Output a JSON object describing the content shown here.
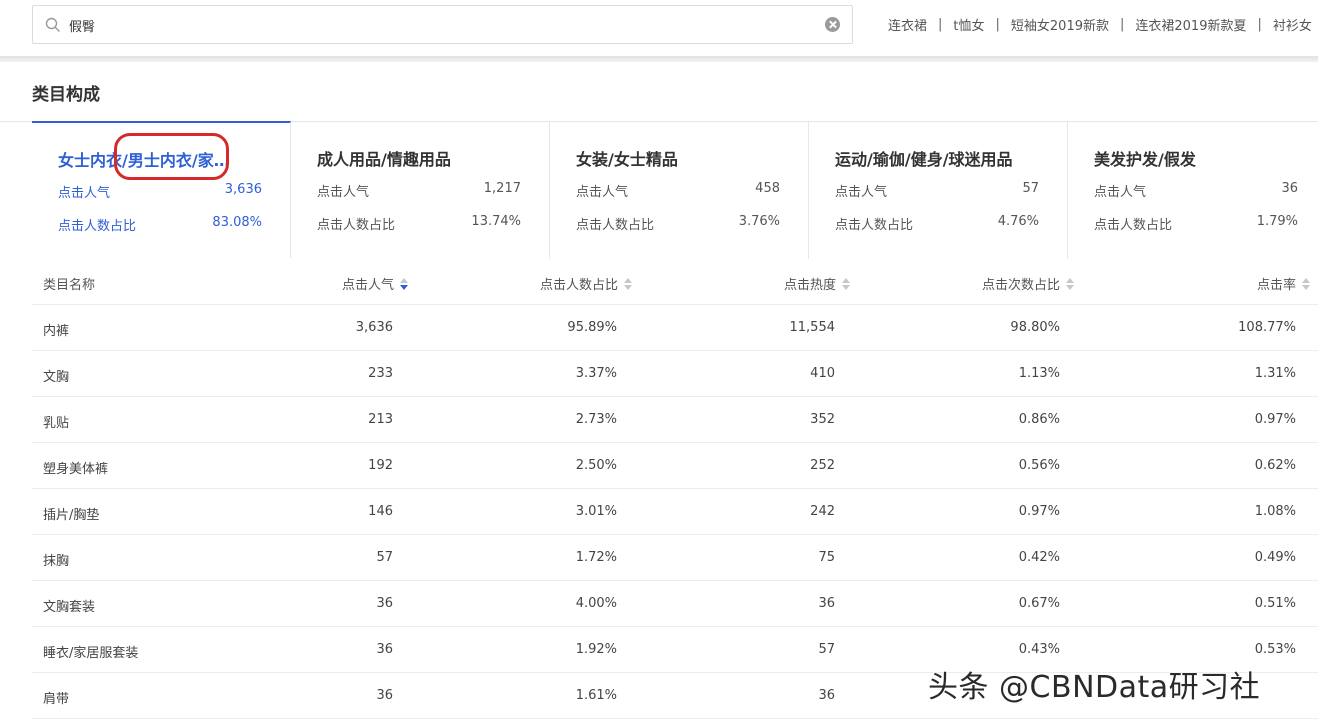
{
  "search": {
    "value": "假臀",
    "hot_words": [
      "连衣裙",
      "t恤女",
      "短袖女2019新款",
      "连衣裙2019新款夏",
      "衬衫女"
    ]
  },
  "section": {
    "title": "类目构成"
  },
  "categories": [
    {
      "name": "女士内衣/男士内衣/家…",
      "click_popularity_label": "点击人气",
      "click_popularity": "3,636",
      "click_share_label": "点击人数占比",
      "click_share": "83.08%",
      "active": true
    },
    {
      "name": "成人用品/情趣用品",
      "click_popularity_label": "点击人气",
      "click_popularity": "1,217",
      "click_share_label": "点击人数占比",
      "click_share": "13.74%",
      "active": false
    },
    {
      "name": "女装/女士精品",
      "click_popularity_label": "点击人气",
      "click_popularity": "458",
      "click_share_label": "点击人数占比",
      "click_share": "3.76%",
      "active": false
    },
    {
      "name": "运动/瑜伽/健身/球迷用品",
      "click_popularity_label": "点击人气",
      "click_popularity": "57",
      "click_share_label": "点击人数占比",
      "click_share": "4.76%",
      "active": false
    },
    {
      "name": "美发护发/假发",
      "click_popularity_label": "点击人气",
      "click_popularity": "36",
      "click_share_label": "点击人数占比",
      "click_share": "1.79%",
      "active": false
    }
  ],
  "table": {
    "headers": [
      "类目名称",
      "点击人气",
      "点击人数占比",
      "点击热度",
      "点击次数占比",
      "点击率"
    ],
    "rows": [
      [
        "内裤",
        "3,636",
        "95.89%",
        "11,554",
        "98.80%",
        "108.77%"
      ],
      [
        "文胸",
        "233",
        "3.37%",
        "410",
        "1.13%",
        "1.31%"
      ],
      [
        "乳贴",
        "213",
        "2.73%",
        "352",
        "0.86%",
        "0.97%"
      ],
      [
        "塑身美体裤",
        "192",
        "2.50%",
        "252",
        "0.56%",
        "0.62%"
      ],
      [
        "插片/胸垫",
        "146",
        "3.01%",
        "242",
        "0.97%",
        "1.08%"
      ],
      [
        "抹胸",
        "57",
        "1.72%",
        "75",
        "0.42%",
        "0.49%"
      ],
      [
        "文胸套装",
        "36",
        "4.00%",
        "36",
        "0.67%",
        "0.51%"
      ],
      [
        "睡衣/家居服套装",
        "36",
        "1.92%",
        "57",
        "0.43%",
        "0.53%"
      ],
      [
        "肩带",
        "36",
        "1.61%",
        "36",
        "",
        ""
      ]
    ]
  },
  "watermark": "头条 @CBNData研习社",
  "colors": {
    "accent": "#2e5fd6",
    "highlight": "#d42a2a"
  }
}
